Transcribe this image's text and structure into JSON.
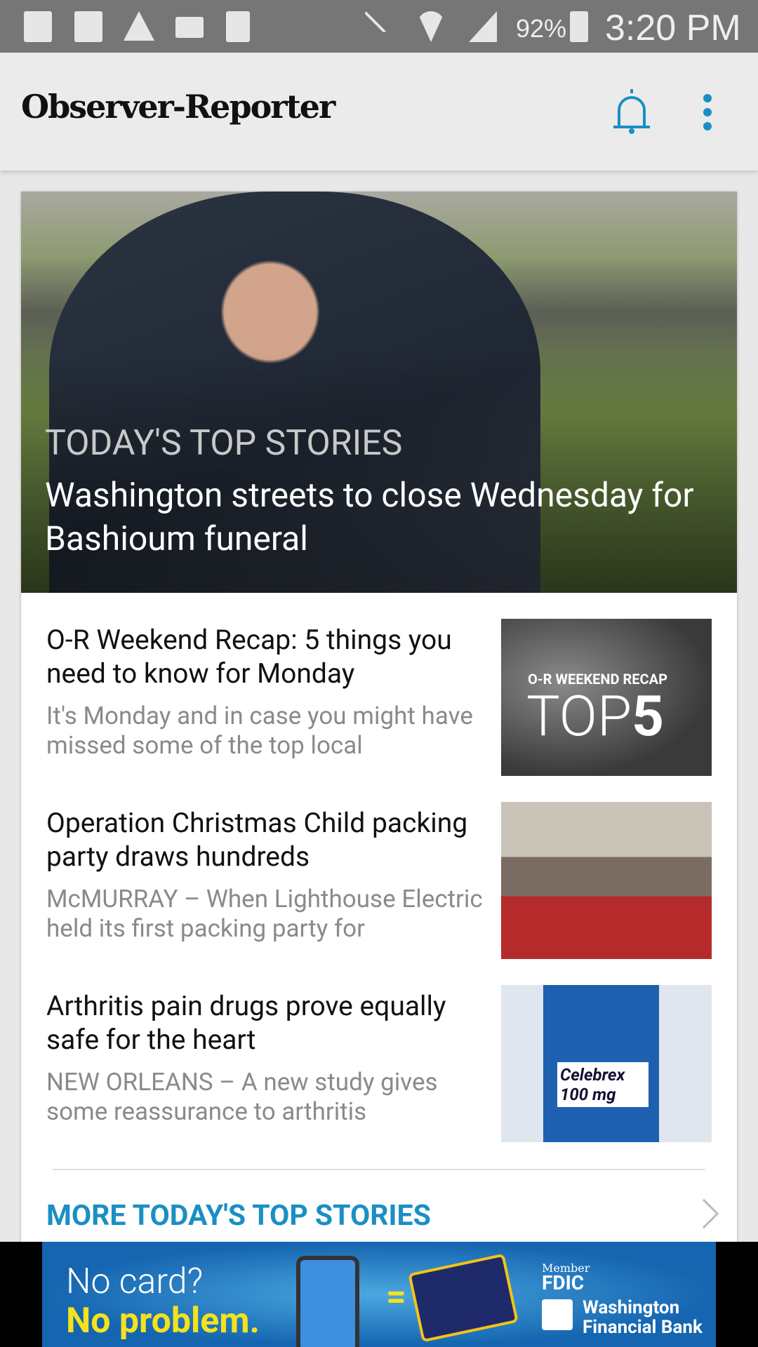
{
  "status_bar": {
    "battery": "92%",
    "time": "3:20 PM",
    "icons": [
      "copy-icon",
      "news-icon",
      "warning-icon",
      "voicemail-icon",
      "sim-error-icon",
      "mute-icon",
      "wifi-icon",
      "signal-icon",
      "battery-charging-icon"
    ]
  },
  "app_bar": {
    "logo": "Observer-Reporter",
    "accent": "#1a8fc4"
  },
  "hero": {
    "kicker": "TODAY'S TOP STORIES",
    "headline": "Washington streets to close Wednesday for Bashioum funeral"
  },
  "stories": [
    {
      "title": "O-R Weekend Recap: 5 things you need to know for Monday",
      "summary": "It's Monday and in case you might have missed some of the top local",
      "thumb_kicker": "O-R WEEKEND RECAP",
      "thumb_top": "TOP",
      "thumb_num": "5"
    },
    {
      "title": "Operation Christmas Child packing party draws hundreds",
      "summary": "McMURRAY – When Lighthouse Electric held its first packing party for"
    },
    {
      "title": "Arthritis pain drugs prove equally safe for the heart",
      "summary": "NEW ORLEANS – A new study gives some reassurance to arthritis",
      "thumb_label": "Celebrex 100 mg"
    }
  ],
  "more_link": "MORE TODAY'S TOP STORIES",
  "ad": {
    "line1": "No card?",
    "line2": "No problem.",
    "member": "Member",
    "fdic": "FDIC",
    "bank": "Washington Financial Bank"
  }
}
